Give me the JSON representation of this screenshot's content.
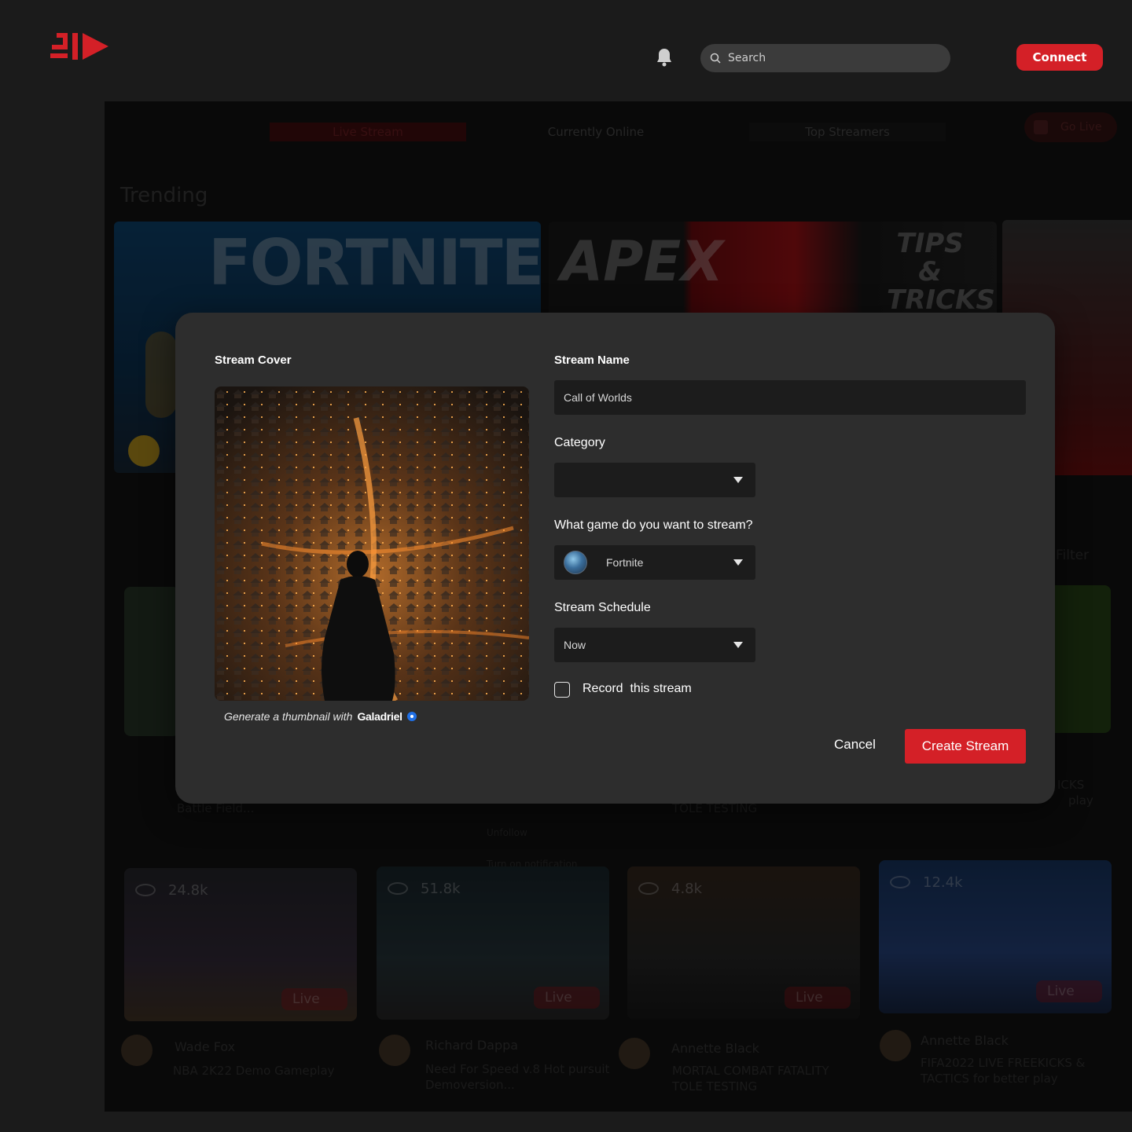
{
  "header": {
    "logo": "streaming-logo",
    "search_placeholder": "Search",
    "connect_label": "Connect"
  },
  "background": {
    "tabs": [
      "Live Stream",
      "Currently Online",
      "Top Streamers"
    ],
    "go_live_label": "Go Live",
    "section_title": "Trending",
    "banner_texts": [
      "FORTNITE",
      "APEX",
      "TIPS & TRICKS"
    ],
    "filter_label": "Filter",
    "context_menu": [
      "Unfollow",
      "Turn on notification"
    ],
    "partial_titles": [
      "Battle Field...",
      "TOLE TESTING",
      "ICKS",
      "play"
    ],
    "cards": [
      {
        "viewers": "24.8k",
        "live": "Live",
        "streamer": "Wade Fox",
        "title": "NBA 2K22 Demo Gameplay"
      },
      {
        "viewers": "51.8k",
        "live": "Live",
        "streamer": "Richard Dappa",
        "title": "Need For Speed v.8 Hot pursuit Demoversion..."
      },
      {
        "viewers": "4.8k",
        "live": "Live",
        "streamer": "Annette Black",
        "title": "MORTAL COMBAT FATALITY TOLE TESTING"
      },
      {
        "viewers": "12.4k",
        "live": "Live",
        "streamer": "Annette Black",
        "title": "FIFA2022 LIVE FREEKICKS & TACTICS for better play"
      }
    ]
  },
  "modal": {
    "cover_label": "Stream Cover",
    "generate_text": "Generate a thumbnail with",
    "generate_brand": "Galadriel",
    "name_label": "Stream Name",
    "name_value": "Call of Worlds",
    "category_label": "Category",
    "category_value": "",
    "game_label": "What game do you want to stream?",
    "game_value": "Fortnite",
    "schedule_label": "Stream Schedule",
    "schedule_value": "Now",
    "record_label": "Record  this stream",
    "record_checked": false,
    "cancel_label": "Cancel",
    "create_label": "Create Stream"
  },
  "colors": {
    "accent": "#d42027",
    "modal_bg": "#2d2d2d",
    "page_bg": "#1b1b1b",
    "field_bg": "#1c1c1c"
  }
}
